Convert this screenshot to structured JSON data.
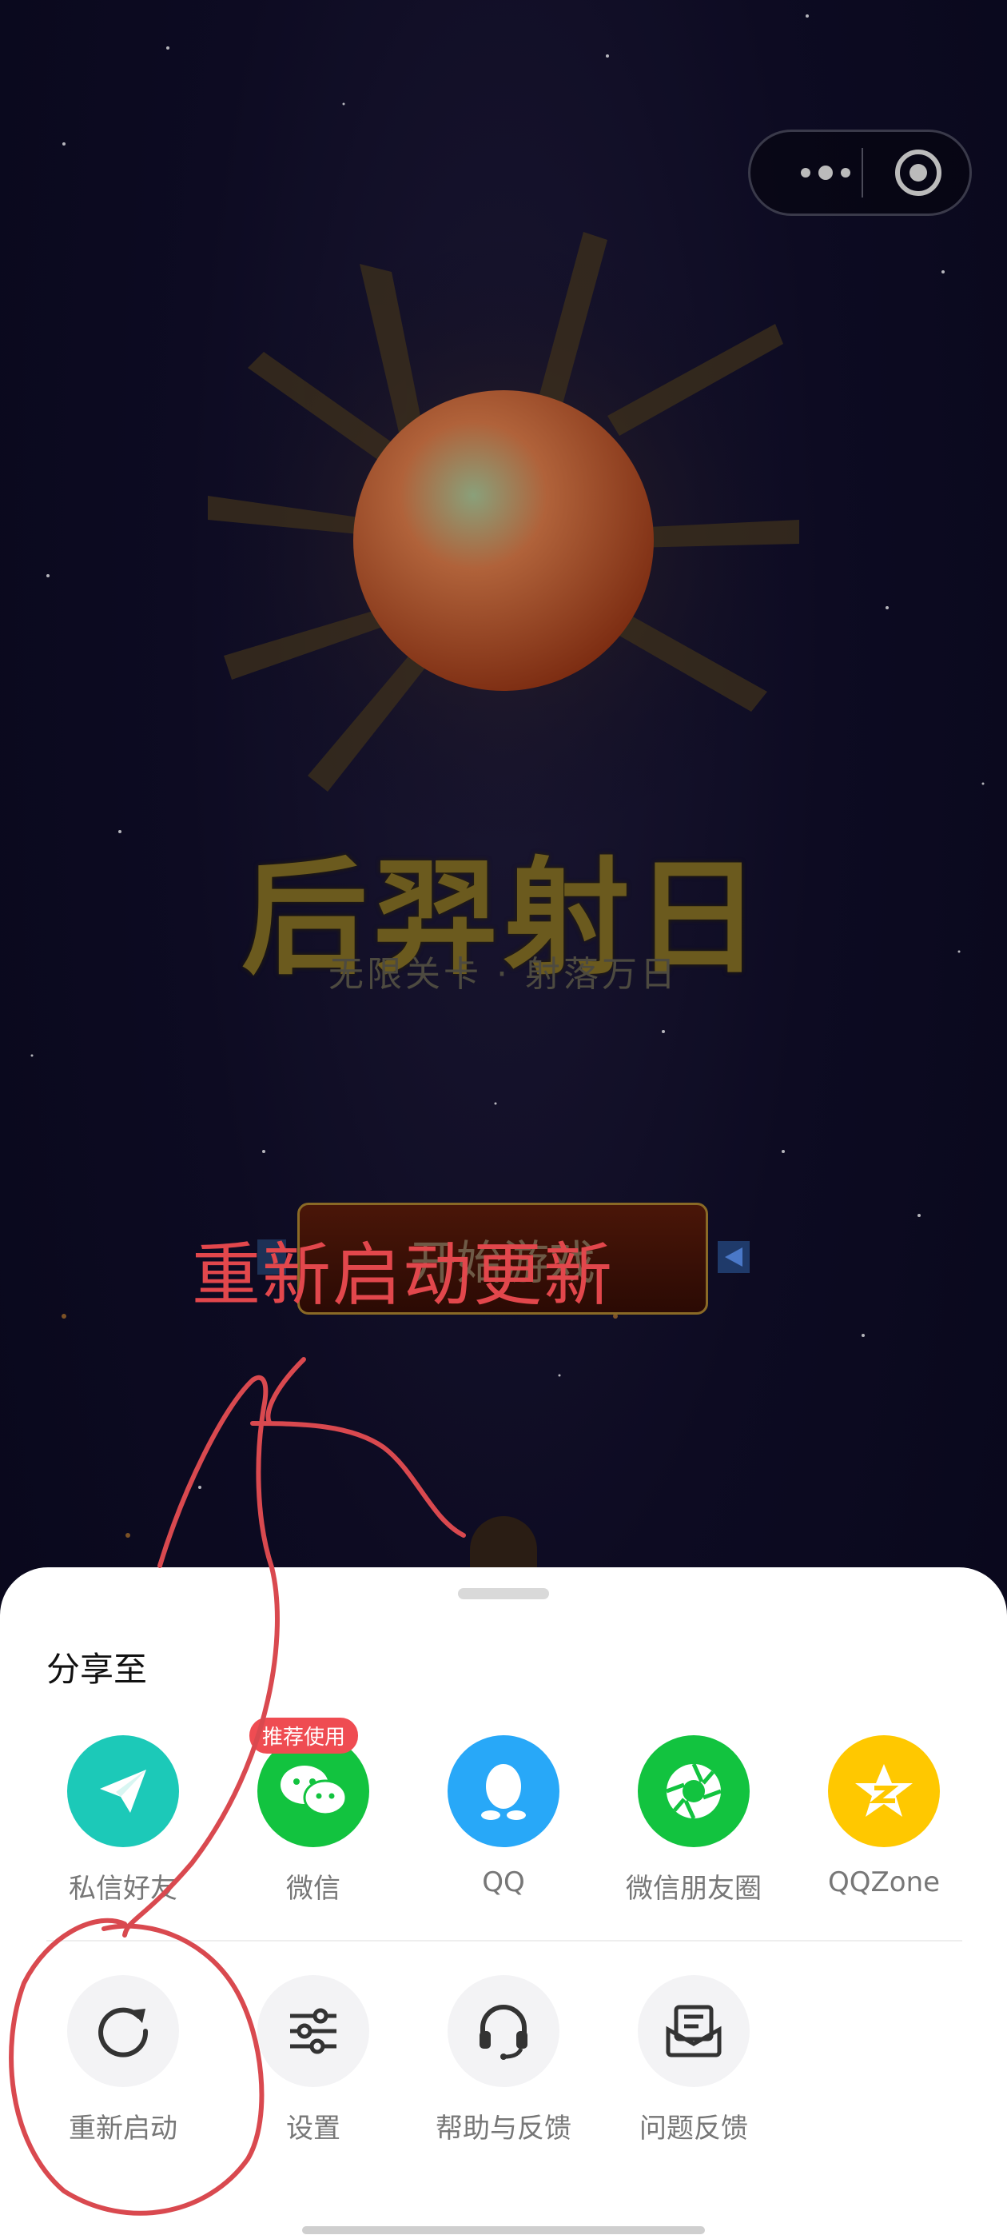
{
  "game": {
    "title": "后羿射日",
    "subtitle": "无限关卡 · 射落万日",
    "start_button": "开始游戏"
  },
  "annotation": {
    "text": "重新启动更新"
  },
  "share_sheet": {
    "title": "分享至",
    "share_items": [
      {
        "label": "私信好友",
        "icon": "paper-plane-icon",
        "color": "#1cc9b8"
      },
      {
        "label": "微信",
        "icon": "wechat-icon",
        "color": "#12c33f",
        "badge": "推荐使用"
      },
      {
        "label": "QQ",
        "icon": "qq-penguin-icon",
        "color": "#28a8f8"
      },
      {
        "label": "微信朋友圈",
        "icon": "moments-aperture-icon",
        "color": "#12c33f"
      },
      {
        "label": "QQZone",
        "icon": "qzone-star-icon",
        "color": "#ffc800"
      }
    ],
    "actions": [
      {
        "label": "重新启动",
        "icon": "restart-icon"
      },
      {
        "label": "设置",
        "icon": "settings-sliders-icon"
      },
      {
        "label": "帮助与反馈",
        "icon": "headset-icon"
      },
      {
        "label": "问题反馈",
        "icon": "feedback-envelope-icon"
      }
    ]
  },
  "colors": {
    "annotation_red": "#e2474c",
    "sheet_bg": "#ffffff",
    "game_bg": "#0b0a1d"
  }
}
